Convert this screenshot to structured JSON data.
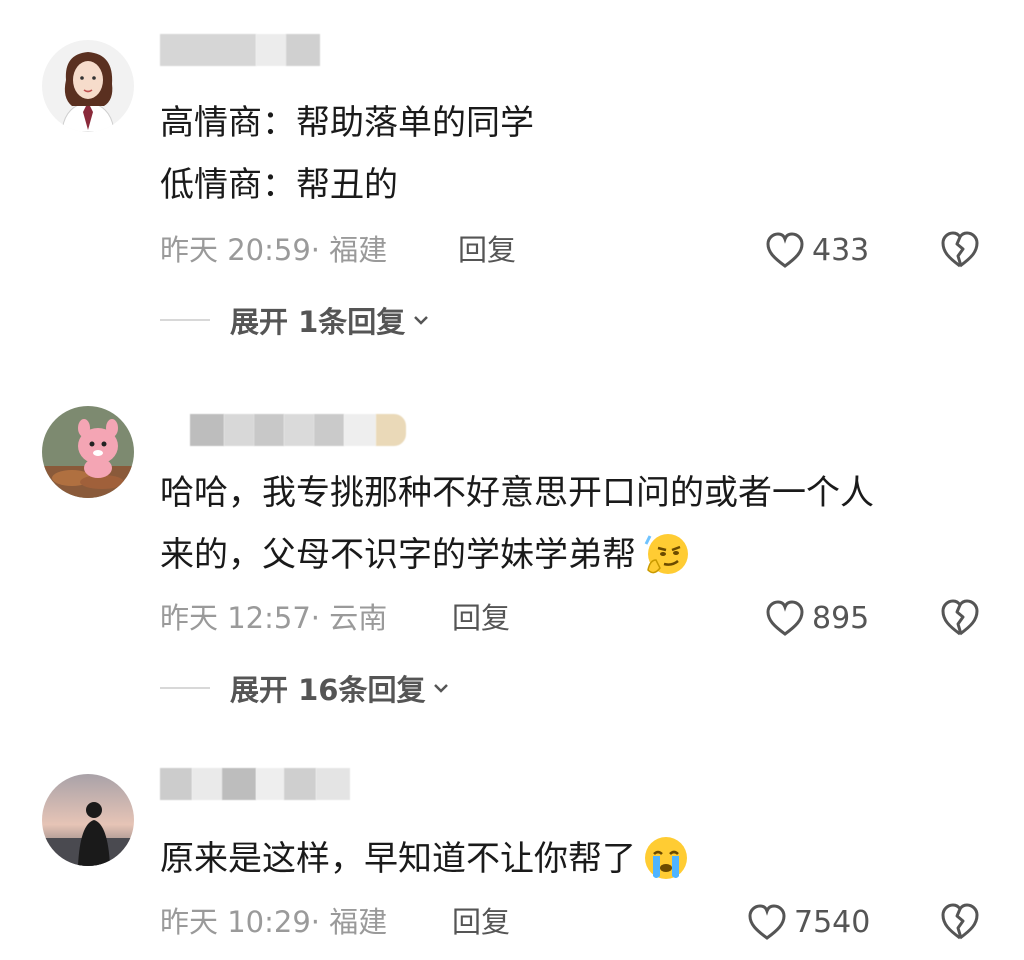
{
  "comments": [
    {
      "lines": [
        "高情商：帮助落单的同学",
        "低情商：帮丑的"
      ],
      "time": "昨天 20:59",
      "location": "福建",
      "reply_label": "回复",
      "likes": "433",
      "expand_label": "展开 1条回复",
      "avatar_icon": "girl-uniform-avatar"
    },
    {
      "lines": [
        "哈哈，我专挑那种不好意思开口问的或者一个人",
        "来的，父母不识字的学妹学弟帮"
      ],
      "time": "昨天 12:57",
      "location": "云南",
      "reply_label": "回复",
      "likes": "895",
      "expand_label": "展开 16条回复",
      "avatar_icon": "pink-plush-avatar",
      "emoji": "smirk-emoji"
    },
    {
      "lines": [
        "原来是这样，早知道不让你帮了"
      ],
      "time": "昨天 10:29",
      "location": "福建",
      "reply_label": "回复",
      "likes": "7540",
      "avatar_icon": "silhouette-sunset-avatar",
      "emoji": "crying-emoji"
    }
  ],
  "colors": {
    "text": "#1a1a1a",
    "meta": "#9a9a9a",
    "action": "#555555"
  }
}
